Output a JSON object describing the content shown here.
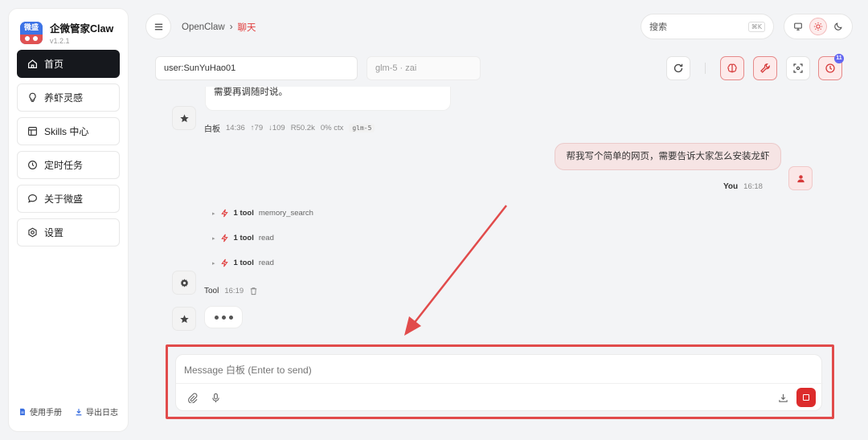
{
  "app": {
    "name": "企微管家Claw",
    "version": "v1.2.1",
    "logo_text": "微盛"
  },
  "sidebar": {
    "items": [
      {
        "label": "首页",
        "icon": "home-icon"
      },
      {
        "label": "养虾灵感",
        "icon": "lightbulb-icon"
      },
      {
        "label": "Skills 中心",
        "icon": "layout-icon"
      },
      {
        "label": "定时任务",
        "icon": "clock-icon"
      },
      {
        "label": "关于微盛",
        "icon": "chat-bubble-icon"
      },
      {
        "label": "设置",
        "icon": "gear-icon"
      }
    ],
    "active_index": 0,
    "footer": {
      "manual": "使用手册",
      "export_logs": "导出日志"
    }
  },
  "header": {
    "breadcrumb_root": "OpenClaw",
    "breadcrumb_sep": "›",
    "breadcrumb_current": "聊天",
    "search_placeholder": "搜索",
    "search_shortcut": "⌘K"
  },
  "session": {
    "user": "user:SunYuHao01",
    "model": "glm-5 · zai",
    "schedule_badge": "11"
  },
  "messages": {
    "prev_assistant_text": "需要再调随时说。",
    "prev_meta": {
      "who": "白板",
      "time": "14:36",
      "up": "↑79",
      "down": "↓109",
      "r": "R50.2k",
      "ctx": "0% ctx",
      "model": "glm-5"
    },
    "user_text": "帮我写个简单的网页，需要告诉大家怎么安装龙虾",
    "user_meta": {
      "who": "You",
      "time": "16:18"
    },
    "tool_calls": [
      {
        "count": "1 tool",
        "name": "memory_search"
      },
      {
        "count": "1 tool",
        "name": "read"
      },
      {
        "count": "1 tool",
        "name": "read"
      }
    ],
    "tool_meta": {
      "who": "Tool",
      "time": "16:19"
    }
  },
  "composer": {
    "placeholder": "Message 白板 (Enter to send)"
  },
  "colors": {
    "accent": "#e03b3b",
    "stop": "#dc2c2c",
    "annotation": "#e14b4b",
    "active_nav": "#16181d"
  }
}
